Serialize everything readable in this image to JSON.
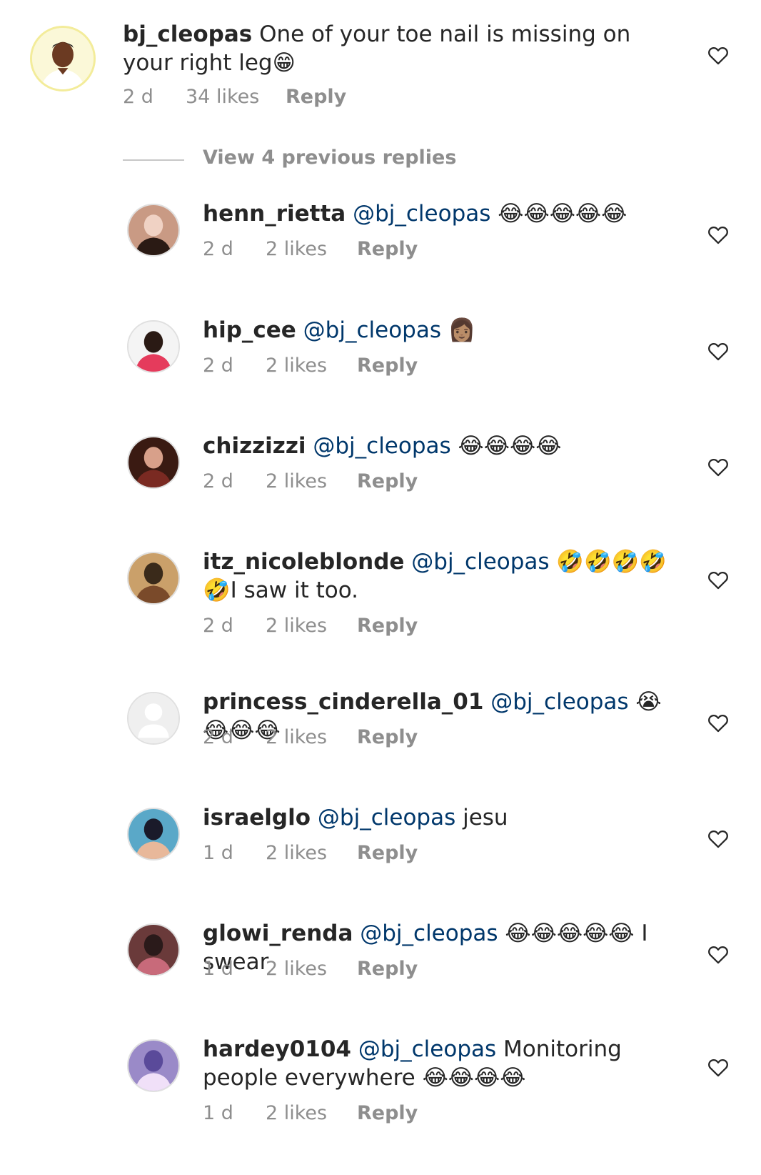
{
  "parent": {
    "username": "bj_cleopas",
    "text": "One of your toe nail is missing on your right leg😁",
    "time": "2 d",
    "likes": "34 likes",
    "reply": "Reply"
  },
  "view_previous": "View 4 previous replies",
  "replies": [
    {
      "username": "henn_rietta",
      "mention": "@bj_cleopas",
      "text": " 😂😂😂😂😂",
      "time": "2 d",
      "likes": "2 likes",
      "reply": "Reply"
    },
    {
      "username": "hip_cee",
      "mention": "@bj_cleopas",
      "text": " 👩🏽",
      "time": "2 d",
      "likes": "2 likes",
      "reply": "Reply"
    },
    {
      "username": "chizzizzi",
      "mention": "@bj_cleopas",
      "text": " 😂😂😂😂",
      "time": "2 d",
      "likes": "2 likes",
      "reply": "Reply"
    },
    {
      "username": "itz_nicoleblonde",
      "mention": "@bj_cleopas",
      "text": " 🤣🤣🤣🤣🤣I saw it too.",
      "time": "2 d",
      "likes": "2 likes",
      "reply": "Reply"
    },
    {
      "username": "princess_cinderella_01",
      "mention": "@bj_cleopas",
      "text": " 😭😂😂😂",
      "time": "2 d",
      "likes": "2 likes",
      "reply": "Reply"
    },
    {
      "username": "israelglo",
      "mention": "@bj_cleopas",
      "text": " jesu",
      "time": "1 d",
      "likes": "2 likes",
      "reply": "Reply"
    },
    {
      "username": "glowi_renda",
      "mention": "@bj_cleopas",
      "text": " 😂😂😂😂😂 I swear",
      "time": "1 d",
      "likes": "2 likes",
      "reply": "Reply"
    },
    {
      "username": "hardey0104",
      "mention": "@bj_cleopas",
      "text": " Monitoring people everywhere 😂😂😂😂",
      "time": "1 d",
      "likes": "2 likes",
      "reply": "Reply"
    }
  ],
  "icons": {
    "like": "heart-outline-icon",
    "avatar_placeholder": "default-avatar-icon"
  },
  "colors": {
    "username": "#262626",
    "mention": "#00376b",
    "meta": "#8e8e8e",
    "heart": "#262626"
  }
}
